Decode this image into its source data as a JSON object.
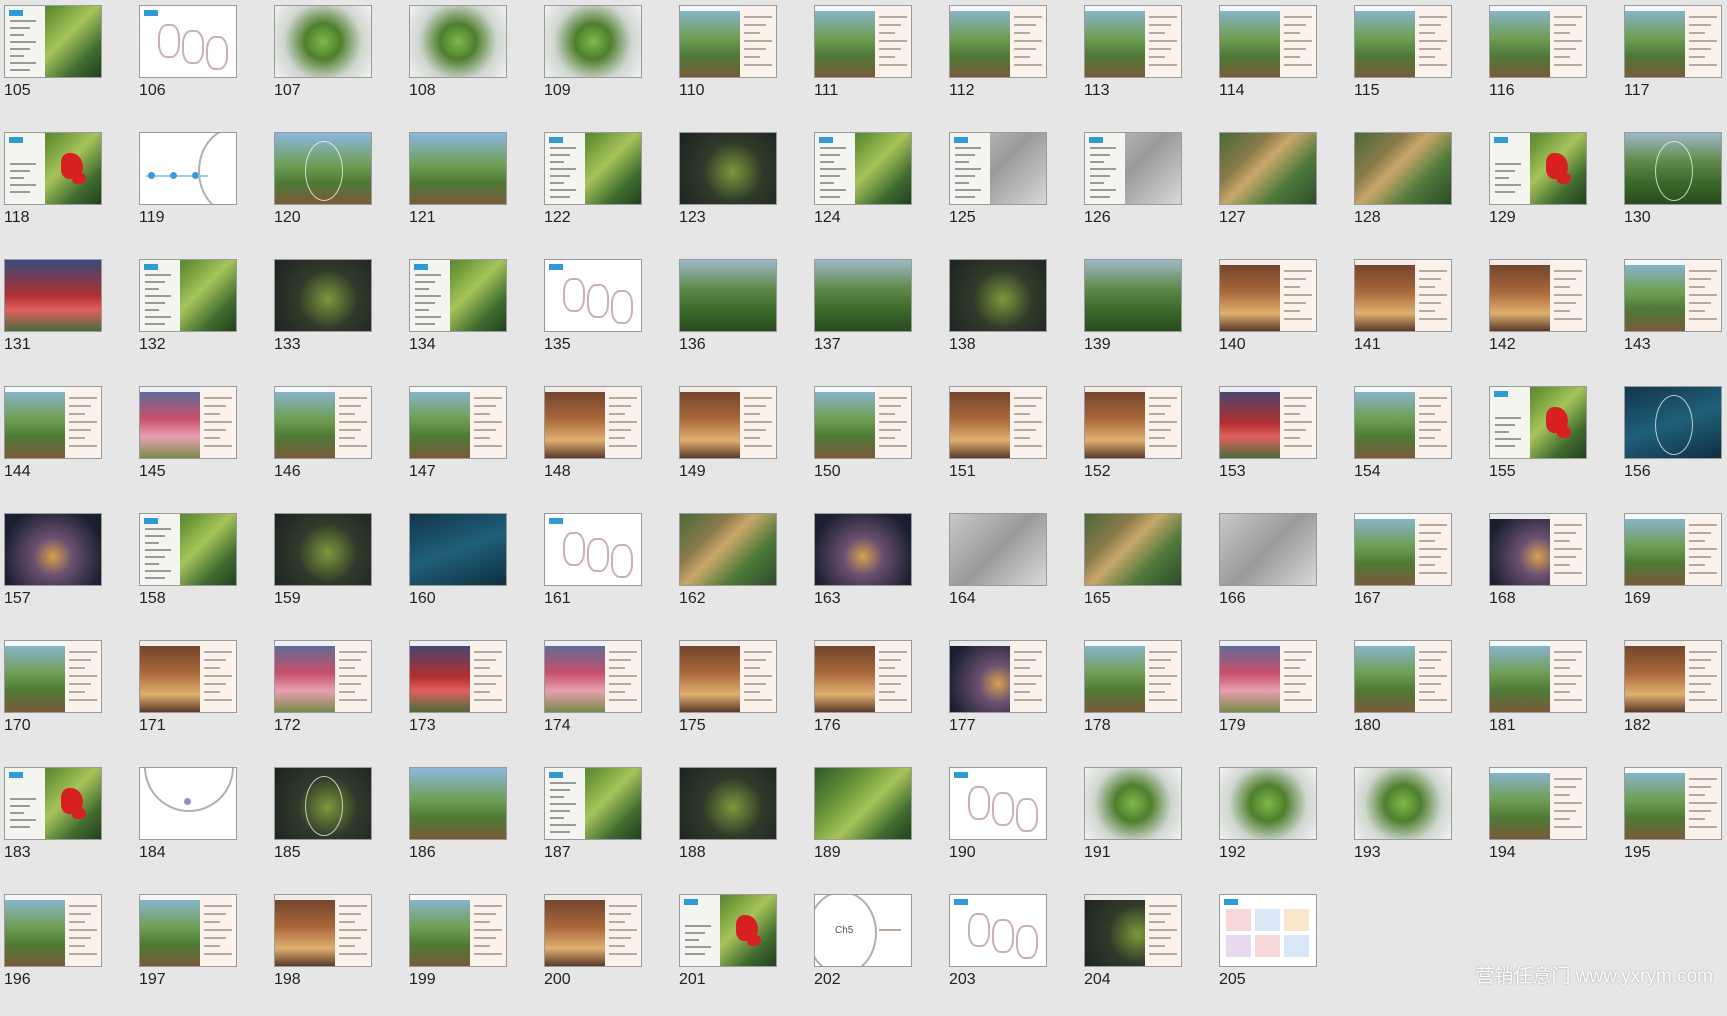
{
  "slides": [
    {
      "number": "105",
      "style": "map",
      "layout": "left-list"
    },
    {
      "number": "106",
      "style": "white",
      "layout": "diagram"
    },
    {
      "number": "107",
      "style": "mist",
      "layout": "plain"
    },
    {
      "number": "108",
      "style": "mist",
      "layout": "plain"
    },
    {
      "number": "109",
      "style": "mist",
      "layout": "plain"
    },
    {
      "number": "110",
      "style": "photo",
      "layout": "right-text"
    },
    {
      "number": "111",
      "style": "photo",
      "layout": "right-text"
    },
    {
      "number": "112",
      "style": "photo",
      "layout": "right-text"
    },
    {
      "number": "113",
      "style": "photo",
      "layout": "right-text"
    },
    {
      "number": "114",
      "style": "photo",
      "layout": "right-text"
    },
    {
      "number": "115",
      "style": "photo",
      "layout": "right-text"
    },
    {
      "number": "116",
      "style": "photo",
      "layout": "right-text"
    },
    {
      "number": "117",
      "style": "photo",
      "layout": "right-text"
    },
    {
      "number": "118",
      "style": "map",
      "layout": "hotspot"
    },
    {
      "number": "119",
      "style": "white",
      "layout": "dots"
    },
    {
      "number": "120",
      "style": "photo",
      "layout": "oval"
    },
    {
      "number": "121",
      "style": "photo",
      "layout": "plain"
    },
    {
      "number": "122",
      "style": "map",
      "layout": "left-list"
    },
    {
      "number": "123",
      "style": "dark",
      "layout": "plain"
    },
    {
      "number": "124",
      "style": "map",
      "layout": "left-list"
    },
    {
      "number": "125",
      "style": "gray",
      "layout": "left-list"
    },
    {
      "number": "126",
      "style": "gray",
      "layout": "left-list"
    },
    {
      "number": "127",
      "style": "aerial",
      "layout": "plain"
    },
    {
      "number": "128",
      "style": "aerial",
      "layout": "plain"
    },
    {
      "number": "129",
      "style": "map",
      "layout": "hotspot"
    },
    {
      "number": "130",
      "style": "forest",
      "layout": "oval"
    },
    {
      "number": "131",
      "style": "red",
      "layout": "plain"
    },
    {
      "number": "132",
      "style": "map",
      "layout": "left-list"
    },
    {
      "number": "133",
      "style": "dark",
      "layout": "plain"
    },
    {
      "number": "134",
      "style": "map",
      "layout": "left-list"
    },
    {
      "number": "135",
      "style": "white",
      "layout": "diagram"
    },
    {
      "number": "136",
      "style": "forest",
      "layout": "plain"
    },
    {
      "number": "137",
      "style": "forest",
      "layout": "plain"
    },
    {
      "number": "138",
      "style": "dark",
      "layout": "plain"
    },
    {
      "number": "139",
      "style": "forest",
      "layout": "plain"
    },
    {
      "number": "140",
      "style": "warm",
      "layout": "right-text"
    },
    {
      "number": "141",
      "style": "warm",
      "layout": "right-text"
    },
    {
      "number": "142",
      "style": "warm",
      "layout": "right-text"
    },
    {
      "number": "143",
      "style": "photo",
      "layout": "right-text"
    },
    {
      "number": "144",
      "style": "photo",
      "layout": "right-text"
    },
    {
      "number": "145",
      "style": "flower",
      "layout": "right-text"
    },
    {
      "number": "146",
      "style": "photo",
      "layout": "right-text"
    },
    {
      "number": "147",
      "style": "photo",
      "layout": "right-text"
    },
    {
      "number": "148",
      "style": "warm",
      "layout": "right-text"
    },
    {
      "number": "149",
      "style": "warm",
      "layout": "right-text"
    },
    {
      "number": "150",
      "style": "photo",
      "layout": "right-text"
    },
    {
      "number": "151",
      "style": "warm",
      "layout": "right-text"
    },
    {
      "number": "152",
      "style": "warm",
      "layout": "right-text"
    },
    {
      "number": "153",
      "style": "red",
      "layout": "right-text"
    },
    {
      "number": "154",
      "style": "photo",
      "layout": "right-text"
    },
    {
      "number": "155",
      "style": "map",
      "layout": "hotspot"
    },
    {
      "number": "156",
      "style": "teal",
      "layout": "oval"
    },
    {
      "number": "157",
      "style": "night",
      "layout": "plain"
    },
    {
      "number": "158",
      "style": "map",
      "layout": "left-list"
    },
    {
      "number": "159",
      "style": "dark",
      "layout": "plain"
    },
    {
      "number": "160",
      "style": "teal",
      "layout": "plain"
    },
    {
      "number": "161",
      "style": "white",
      "layout": "diagram"
    },
    {
      "number": "162",
      "style": "aerial",
      "layout": "plain"
    },
    {
      "number": "163",
      "style": "night",
      "layout": "plain"
    },
    {
      "number": "164",
      "style": "gray",
      "layout": "plain"
    },
    {
      "number": "165",
      "style": "aerial",
      "layout": "plain"
    },
    {
      "number": "166",
      "style": "gray",
      "layout": "plain"
    },
    {
      "number": "167",
      "style": "photo",
      "layout": "right-text"
    },
    {
      "number": "168",
      "style": "night",
      "layout": "right-text"
    },
    {
      "number": "169",
      "style": "photo",
      "layout": "right-text"
    },
    {
      "number": "170",
      "style": "photo",
      "layout": "right-text"
    },
    {
      "number": "171",
      "style": "warm",
      "layout": "right-text"
    },
    {
      "number": "172",
      "style": "flower",
      "layout": "right-text"
    },
    {
      "number": "173",
      "style": "red",
      "layout": "right-text"
    },
    {
      "number": "174",
      "style": "flower",
      "layout": "right-text"
    },
    {
      "number": "175",
      "style": "warm",
      "layout": "right-text"
    },
    {
      "number": "176",
      "style": "warm",
      "layout": "right-text"
    },
    {
      "number": "177",
      "style": "night",
      "layout": "right-text"
    },
    {
      "number": "178",
      "style": "photo",
      "layout": "right-text"
    },
    {
      "number": "179",
      "style": "flower",
      "layout": "right-text"
    },
    {
      "number": "180",
      "style": "photo",
      "layout": "right-text"
    },
    {
      "number": "181",
      "style": "photo",
      "layout": "right-text"
    },
    {
      "number": "182",
      "style": "warm",
      "layout": "right-text"
    },
    {
      "number": "183",
      "style": "map",
      "layout": "hotspot"
    },
    {
      "number": "184",
      "style": "white",
      "layout": "ring"
    },
    {
      "number": "185",
      "style": "dark",
      "layout": "oval"
    },
    {
      "number": "186",
      "style": "photo",
      "layout": "plain"
    },
    {
      "number": "187",
      "style": "map",
      "layout": "left-list"
    },
    {
      "number": "188",
      "style": "dark",
      "layout": "plain"
    },
    {
      "number": "189",
      "style": "map",
      "layout": "plain"
    },
    {
      "number": "190",
      "style": "white",
      "layout": "diagram"
    },
    {
      "number": "191",
      "style": "mist",
      "layout": "plain"
    },
    {
      "number": "192",
      "style": "mist",
      "layout": "plain"
    },
    {
      "number": "193",
      "style": "mist",
      "layout": "plain"
    },
    {
      "number": "194",
      "style": "photo",
      "layout": "right-text"
    },
    {
      "number": "195",
      "style": "photo",
      "layout": "right-text"
    },
    {
      "number": "196",
      "style": "photo",
      "layout": "right-text"
    },
    {
      "number": "197",
      "style": "photo",
      "layout": "right-text"
    },
    {
      "number": "198",
      "style": "warm",
      "layout": "right-text"
    },
    {
      "number": "199",
      "style": "photo",
      "layout": "right-text"
    },
    {
      "number": "200",
      "style": "warm",
      "layout": "right-text"
    },
    {
      "number": "201",
      "style": "map",
      "layout": "hotspot"
    },
    {
      "number": "202",
      "style": "white",
      "layout": "chapter",
      "caption": "Ch5"
    },
    {
      "number": "203",
      "style": "white",
      "layout": "diagram"
    },
    {
      "number": "204",
      "style": "dark",
      "layout": "right-text"
    },
    {
      "number": "205",
      "style": "white",
      "layout": "tiles"
    }
  ],
  "watermark": "营销任意门 www.yxrym.com",
  "colors": {
    "background": "#e6e6e6",
    "accent": "#2e9ad6",
    "hotspot": "#d82020"
  }
}
